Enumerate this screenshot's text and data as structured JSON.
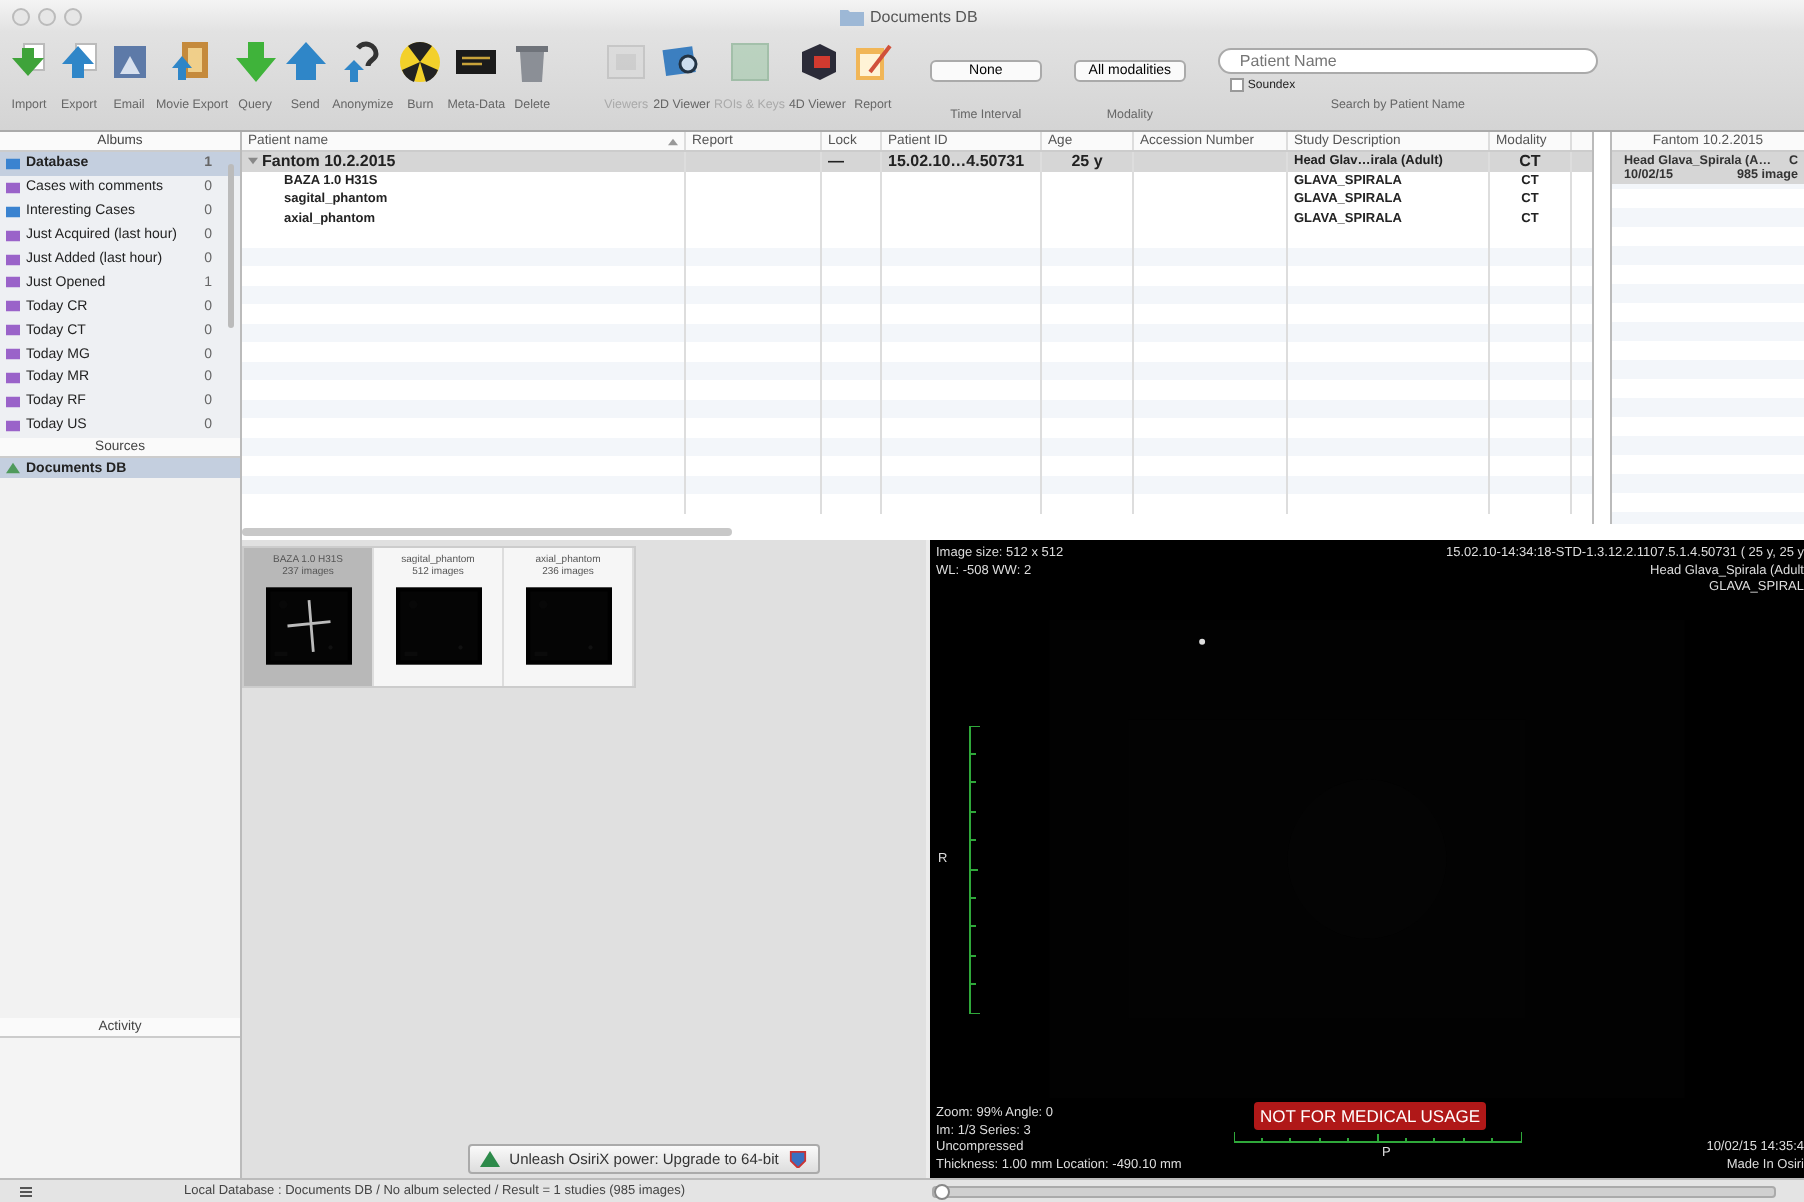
{
  "window": {
    "title": "Documents DB"
  },
  "toolbar": {
    "buttons": [
      {
        "label": "Import",
        "disabled": false
      },
      {
        "label": "Export",
        "disabled": false
      },
      {
        "label": "Email",
        "disabled": false
      },
      {
        "label": "Movie Export",
        "disabled": false
      },
      {
        "label": "Query",
        "disabled": false
      },
      {
        "label": "Send",
        "disabled": false
      },
      {
        "label": "Anonymize",
        "disabled": false
      },
      {
        "label": "Burn",
        "disabled": false
      },
      {
        "label": "Meta-Data",
        "disabled": false
      },
      {
        "label": "Delete",
        "disabled": false
      },
      {
        "label": "Viewers",
        "disabled": true
      },
      {
        "label": "2D Viewer",
        "disabled": false
      },
      {
        "label": "ROIs & Keys",
        "disabled": true
      },
      {
        "label": "4D Viewer",
        "disabled": false
      },
      {
        "label": "Report",
        "disabled": false
      }
    ],
    "time_interval": {
      "value": "None",
      "label": "Time Interval"
    },
    "modality": {
      "value": "All modalities",
      "label": "Modality"
    },
    "search": {
      "placeholder": "Patient Name",
      "label": "Search by Patient Name",
      "soundex": {
        "label": "Soundex",
        "checked": false
      }
    }
  },
  "sidebar": {
    "albums_header": "Albums",
    "albums": [
      {
        "name": "Database",
        "count": "1",
        "selected": true
      },
      {
        "name": "Cases with comments",
        "count": "0",
        "selected": false
      },
      {
        "name": "Interesting Cases",
        "count": "0",
        "selected": false
      },
      {
        "name": "Just Acquired (last hour)",
        "count": "0",
        "selected": false
      },
      {
        "name": "Just Added (last hour)",
        "count": "0",
        "selected": false
      },
      {
        "name": "Just Opened",
        "count": "1",
        "selected": false
      },
      {
        "name": "Today CR",
        "count": "0",
        "selected": false
      },
      {
        "name": "Today CT",
        "count": "0",
        "selected": false
      },
      {
        "name": "Today MG",
        "count": "0",
        "selected": false
      },
      {
        "name": "Today MR",
        "count": "0",
        "selected": false
      },
      {
        "name": "Today RF",
        "count": "0",
        "selected": false
      },
      {
        "name": "Today US",
        "count": "0",
        "selected": false
      }
    ],
    "sources_header": "Sources",
    "sources": [
      {
        "name": "Documents DB",
        "selected": true
      }
    ],
    "activity_header": "Activity"
  },
  "table": {
    "columns": [
      {
        "label": "Patient name",
        "sorted": true
      },
      {
        "label": "Report",
        "sorted": false
      },
      {
        "label": "Lock",
        "sorted": false
      },
      {
        "label": "Patient ID",
        "sorted": false
      },
      {
        "label": "Age",
        "sorted": false
      },
      {
        "label": "Accession Number",
        "sorted": false
      },
      {
        "label": "Study Description",
        "sorted": false
      },
      {
        "label": "Modality",
        "sorted": false
      }
    ],
    "rows": [
      {
        "kind": "study",
        "expanded": true,
        "selected": true,
        "name": "Fantom 10.2.2015",
        "lock": "—",
        "patient_id": "15.02.10…4.50731",
        "age": "25 y",
        "study_description": "Head Glav…irala (Adult)",
        "modality": "CT"
      },
      {
        "kind": "series",
        "selected": false,
        "name": "BAZA 1.0 H31S",
        "study_description": "GLAVA_SPIRALA",
        "modality": "CT"
      },
      {
        "kind": "series",
        "selected": false,
        "name": "sagital_phantom",
        "study_description": "GLAVA_SPIRALA",
        "modality": "CT"
      },
      {
        "kind": "series",
        "selected": false,
        "name": "axial_phantom",
        "study_description": "GLAVA_SPIRALA",
        "modality": "CT"
      }
    ]
  },
  "series_panel": {
    "header": "Fantom 10.2.2015",
    "items": [
      {
        "title": "Head Glava_Spirala (A…",
        "modality": "C",
        "date": "10/02/15",
        "count": "985 image",
        "selected": true
      }
    ]
  },
  "thumbnails": [
    {
      "title": "BAZA 1.0 H31S",
      "count": "237 images",
      "selected": true
    },
    {
      "title": "sagital_phantom",
      "count": "512 images",
      "selected": false
    },
    {
      "title": "axial_phantom",
      "count": "236 images",
      "selected": false
    }
  ],
  "upgrade_banner": "Unleash OsiriX power: Upgrade to 64-bit",
  "viewer": {
    "top_left": [
      "Image size: 512 x 512",
      "WL: -508 WW: 2"
    ],
    "top_right": [
      "15.02.10-14:34:18-STD-1.3.12.2.1107.5.1.4.50731 ( 25 y, 25 y",
      "Head Glava_Spirala (Adult",
      "GLAVA_SPIRAL"
    ],
    "bottom_left": [
      "Zoom: 99% Angle: 0",
      "Im: 1/3 Series: 3",
      "Uncompressed",
      "Thickness: 1.00 mm Location: -490.10 mm"
    ],
    "bottom_right": [
      "10/02/15 14:35:4",
      "Made In Osiri"
    ],
    "orientation_left": "R",
    "orientation_bottom": "P",
    "warning": "NOT FOR MEDICAL USAGE",
    "slider": {
      "level": 0
    }
  },
  "status_bar": "Local Database : Documents DB / No album selected / Result = 1 studies (985 images)"
}
